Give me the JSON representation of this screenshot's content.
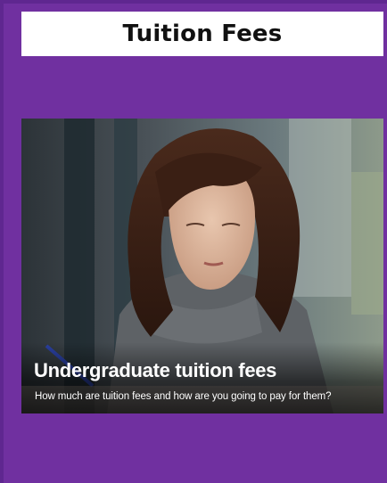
{
  "header": {
    "title": "Tuition Fees"
  },
  "card": {
    "heading": "Undergraduate tuition fees",
    "subheading": "How much are tuition fees and how are you going to pay for them?"
  },
  "colors": {
    "background": "#7030a0",
    "title_bar": "#ffffff",
    "caption_text": "#ffffff"
  }
}
